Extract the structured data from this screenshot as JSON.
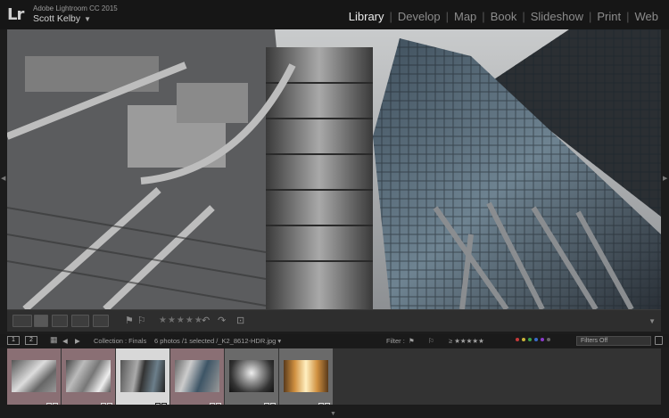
{
  "identity": {
    "logo": "Lr",
    "product": "Adobe Lightroom CC 2015",
    "user": "Scott Kelby",
    "user_caret": "▼"
  },
  "modules": [
    {
      "label": "Library",
      "active": true
    },
    {
      "label": "Develop",
      "active": false
    },
    {
      "label": "Map",
      "active": false
    },
    {
      "label": "Book",
      "active": false
    },
    {
      "label": "Slideshow",
      "active": false
    },
    {
      "label": "Print",
      "active": false
    },
    {
      "label": "Web",
      "active": false
    }
  ],
  "toolbar": {
    "stars": "★★★★★"
  },
  "filmstrip_header": {
    "monitor_1": "1",
    "monitor_2": "2",
    "collection": "Collection : Finals",
    "photo_info": "6 photos /1 selected /_K2_8612-HDR.jpg ▾",
    "filter_label": "Filter :",
    "filters_select": "Filters Off"
  },
  "colors": {
    "accent_selected": "#d8d8d8",
    "label_pink": "#8a6f74",
    "label_gray": "#6a6a6a",
    "panel": "#333333"
  },
  "filmstrip": [
    {
      "label_color": "#8a6f74",
      "selected": false
    },
    {
      "label_color": "#8a6f74",
      "selected": false
    },
    {
      "label_color": "#d8d8d8",
      "selected": true
    },
    {
      "label_color": "#8a6f74",
      "selected": false
    },
    {
      "label_color": "#6a6a6a",
      "selected": false
    },
    {
      "label_color": "#6a6a6a",
      "selected": false
    }
  ]
}
